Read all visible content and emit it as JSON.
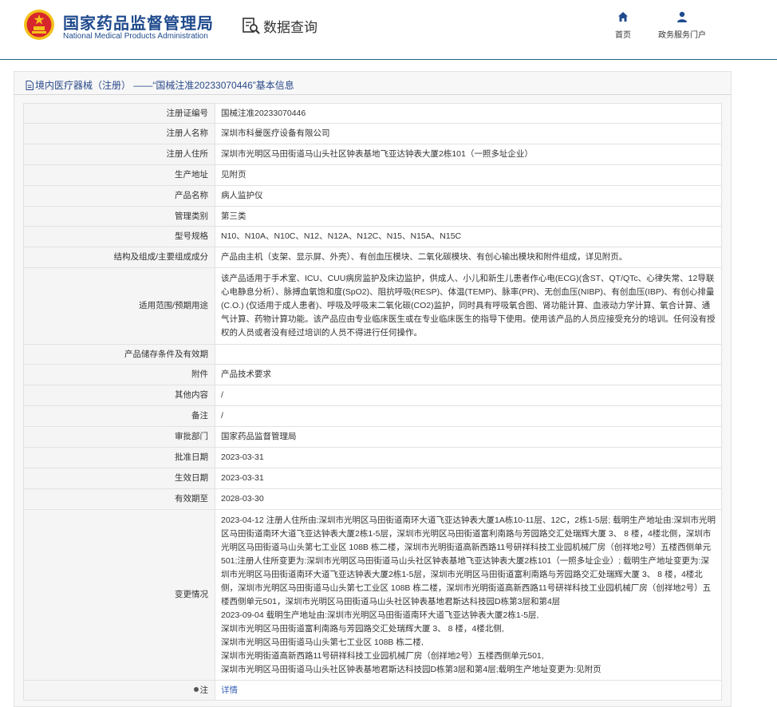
{
  "header": {
    "brand_cn": "国家药品监督管理局",
    "brand_en": "National Medical Products Administration",
    "query_label": "数据查询",
    "nav": {
      "home": "首页",
      "portal": "政务服务门户"
    },
    "colors": {
      "brand": "#1f4a8d",
      "emblem_red": "#d7262c",
      "emblem_gold": "#f4c21b"
    }
  },
  "panel": {
    "title": "境内医疗器械（注册） ——“国械注准20233070446”基本信息"
  },
  "rows": [
    {
      "k": "注册证编号",
      "v": "国械注准20233070446",
      "h": 25
    },
    {
      "k": "注册人名称",
      "v": "深圳市科曼医疗设备有限公司",
      "h": 26
    },
    {
      "k": "注册人住所",
      "v": "深圳市光明区马田街道马山头社区钟表基地飞亚达钟表大厦2栋101（一照多址企业）",
      "h": 26
    },
    {
      "k": "生产地址",
      "v": "见附页",
      "h": 26
    },
    {
      "k": "产品名称",
      "v": "病人监护仪",
      "h": 26
    },
    {
      "k": "管理类别",
      "v": "第三类",
      "h": 25
    },
    {
      "k": "型号规格",
      "v": "N10、N10A、N10C、N12、N12A、N12C、N15、N15A、N15C",
      "h": 26
    },
    {
      "k": "结构及组成/主要组成成分",
      "v": "产品由主机（支架、显示屏、外壳）、有创血压模块、二氧化碳模块、有创心输出模块和附件组成，详见附页。",
      "h": 26
    },
    {
      "k": "适用范围/预期用途",
      "v": "该产品适用于手术室、ICU、CUU病房监护及床边监护，供成人、小儿和新生儿患者作心电(ECG)(含ST、QT/QTc、心律失常、12导联心电静息分析）、脉搏血氧饱和度(SpO2)、阻抗呼吸(RESP)、体温(TEMP)、脉率(PR)、无创血压(NIBP)、有创血压(IBP)、有创心排量 (C.O.) (仅适用于成人患者)、呼吸及呼吸末二氧化碳(CO2)监护，同时具有呼吸氧合图、肾功能计算、血液动力学计算、氧合计算、通气计算、药物计算功能。该产品应由专业临床医生或在专业临床医生的指导下使用。使用该产品的人员应接受充分的培训。任何没有授权的人员或者没有经过培训的人员不得进行任何操作。",
      "h": 96
    },
    {
      "k": "产品储存条件及有效期",
      "v": "",
      "h": 25
    },
    {
      "k": "附件",
      "v": "产品技术要求",
      "h": 26
    },
    {
      "k": "其他内容",
      "v": "/",
      "h": 26
    },
    {
      "k": "备注",
      "v": "/",
      "h": 26
    },
    {
      "k": "审批部门",
      "v": "国家药品监督管理局",
      "h": 26
    },
    {
      "k": "批准日期",
      "v": "2023-03-31",
      "h": 26
    },
    {
      "k": "生效日期",
      "v": "2023-03-31",
      "h": 26
    },
    {
      "k": "有效期至",
      "v": "2028-03-30",
      "h": 26
    },
    {
      "k": "变更情况",
      "v": "2023-04-12 注册人住所由:深圳市光明区马田街道南环大道飞亚达钟表大厦1A栋10-11层、12C，2栋1-5层; 载明生产地址由:深圳市光明区马田街道南环大道飞亚达钟表大厦2栋1-5层，深圳市光明区马田街道富利南路与芳园路交汇处瑞辉大厦 3、 8 楼，4楼北侧，深圳市光明区马田街道马山头第七工业区 108B 栋二楼，深圳市光明街道高新西路11号研祥科技工业园机械厂房（创祥地2号）五楼西侧单元501;注册人住所变更为:深圳市光明区马田街道马山头社区钟表基地飞亚达钟表大厦2栋101（一照多址企业）; 载明生产地址变更为:深圳市光明区马田街道南环大道飞亚达钟表大厦2栋1-5层，深圳市光明区马田街道富利南路与芳园路交汇处瑞辉大厦 3、 8 楼，4楼北侧，深圳市光明区马田街道马山头第七工业区 108B 栋二楼，深圳市光明街道高新西路11号研祥科技工业园机械厂房（创祥地2号）五楼西侧单元501，深圳市光明区马田街道马山头社区钟表基地君斯达科技园D栋第3层和第4层\n2023-09-04 载明生产地址由:深圳市光明区马田街道南环大道飞亚达钟表大厦2栋1-5层,\n深圳市光明区马田街道富利南路与芳园路交汇处瑞辉大厦 3、 8 楼，4楼北侧,\n深圳市光明区马田街道马山头第七工业区 108B 栋二楼,\n深圳市光明街道高新西路11号研祥科技工业园机械厂房（创祥地2号）五楼西侧单元501,\n深圳市光明区马田街道马山头社区钟表基地君斯达科技园D栋第3层和第4层;载明生产地址变更为:见附页",
      "h": 214
    },
    {
      "k": "注",
      "v": "详情",
      "h": 25,
      "link": true,
      "pin": true
    }
  ]
}
